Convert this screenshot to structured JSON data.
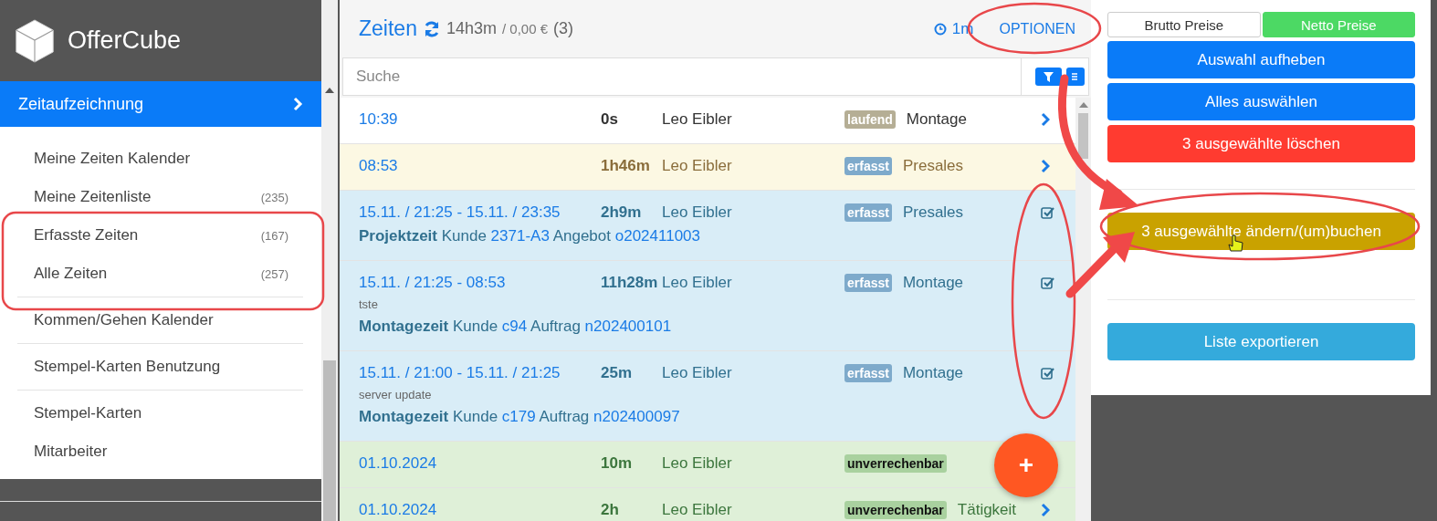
{
  "app": {
    "name": "OfferCube"
  },
  "sidebar": {
    "section": {
      "label": "Zeitaufzeichnung",
      "selected": true
    },
    "groups": [
      [
        {
          "label": "Meine Zeiten Kalender",
          "selected": false
        },
        {
          "label": "Meine Zeitenliste",
          "count": "(235)",
          "selected": false
        },
        {
          "label": "Erfasste Zeiten",
          "count": "(167)",
          "selected": false
        },
        {
          "label": "Alle Zeiten",
          "count": "(257)",
          "selected": false
        }
      ],
      [
        {
          "label": "Kommen/Gehen Kalender",
          "selected": false
        }
      ],
      [
        {
          "label": "Stempel-Karten Benutzung",
          "selected": false
        }
      ],
      [
        {
          "label": "Stempel-Karten",
          "selected": false
        },
        {
          "label": "Mitarbeiter",
          "selected": false
        }
      ]
    ]
  },
  "header": {
    "title": "Zeiten",
    "total": "14h3m",
    "amount": "/ 0,00 €",
    "count": "(3)",
    "timer": "1m",
    "options": "OPTIONEN"
  },
  "search": {
    "placeholder": "Suche"
  },
  "rows": [
    {
      "kind": "default",
      "time": "10:39",
      "duration": "0s",
      "user": "Leo Eibler",
      "badge": {
        "label": "laufend",
        "kind": "state",
        "color": "#b5ae95"
      },
      "activity": "Montage",
      "selected": false,
      "chevron": true
    },
    {
      "kind": "warning",
      "time": "08:53",
      "duration": "1h46m",
      "user": "Leo Eibler",
      "badge": {
        "label": "erfasst",
        "kind": "state",
        "color": "#7eaacb"
      },
      "activity": "Presales",
      "selected": false,
      "chevron": true
    },
    {
      "kind": "info",
      "time": "15.11. / 21:25 - 15.11. / 23:35",
      "duration": "2h9m",
      "user": "Leo Eibler",
      "badge": {
        "label": "erfasst",
        "kind": "state",
        "color": "#7eaacb"
      },
      "activity": "Presales",
      "selected": true,
      "detail": {
        "type": "Projektzeit",
        "parts": [
          {
            "label": "Kunde",
            "link": "2371-A3"
          },
          {
            "label": "Angebot",
            "link": "o202411003"
          }
        ]
      }
    },
    {
      "kind": "info",
      "time": "15.11. / 21:25 - 08:53",
      "duration": "11h28m",
      "user": "Leo Eibler",
      "badge": {
        "label": "erfasst",
        "kind": "state",
        "color": "#7eaacb"
      },
      "activity": "Montage",
      "selected": true,
      "note": "tste",
      "detail": {
        "type": "Montagezeit",
        "parts": [
          {
            "label": "Kunde",
            "link": "c94"
          },
          {
            "label": "Auftrag",
            "link": "n202400101"
          }
        ]
      }
    },
    {
      "kind": "info",
      "time": "15.11. / 21:00 - 15.11. / 21:25",
      "duration": "25m",
      "user": "Leo Eibler",
      "badge": {
        "label": "erfasst",
        "kind": "state",
        "color": "#7eaacb"
      },
      "activity": "Montage",
      "selected": true,
      "note": "server update",
      "detail": {
        "type": "Montagezeit",
        "parts": [
          {
            "label": "Kunde",
            "link": "c179"
          },
          {
            "label": "Auftrag",
            "link": "n202400097"
          }
        ]
      }
    },
    {
      "kind": "success",
      "time": "01.10.2024",
      "duration": "10m",
      "user": "Leo Eibler",
      "badge": {
        "label": "unverrechenbar",
        "kind": "billing",
        "color": "#a9d19f"
      },
      "selected": false,
      "chevron": false
    },
    {
      "kind": "success",
      "time": "01.10.2024",
      "duration": "2h",
      "user": "Leo Eibler",
      "badge": {
        "label": "unverrechenbar",
        "kind": "billing",
        "color": "#a9d19f"
      },
      "activity": "Tätigkeit",
      "selected": false,
      "chevron": true
    }
  ],
  "fab": {
    "label": "+"
  },
  "price_toggle": [
    {
      "label": "Brutto Preise",
      "selected": false
    },
    {
      "label": "Netto Preise",
      "selected": true
    }
  ],
  "actions": [
    [
      {
        "label": "Auswahl aufheben",
        "kind": "primary"
      },
      {
        "label": "Alles auswählen",
        "kind": "primary"
      },
      {
        "label": "3 ausgewählte löschen",
        "kind": "danger"
      }
    ],
    [
      {
        "label": "3 ausgewählte ändern/(um)buchen",
        "kind": "warning"
      }
    ],
    [
      {
        "label": "Liste exportieren",
        "kind": "info"
      }
    ]
  ]
}
